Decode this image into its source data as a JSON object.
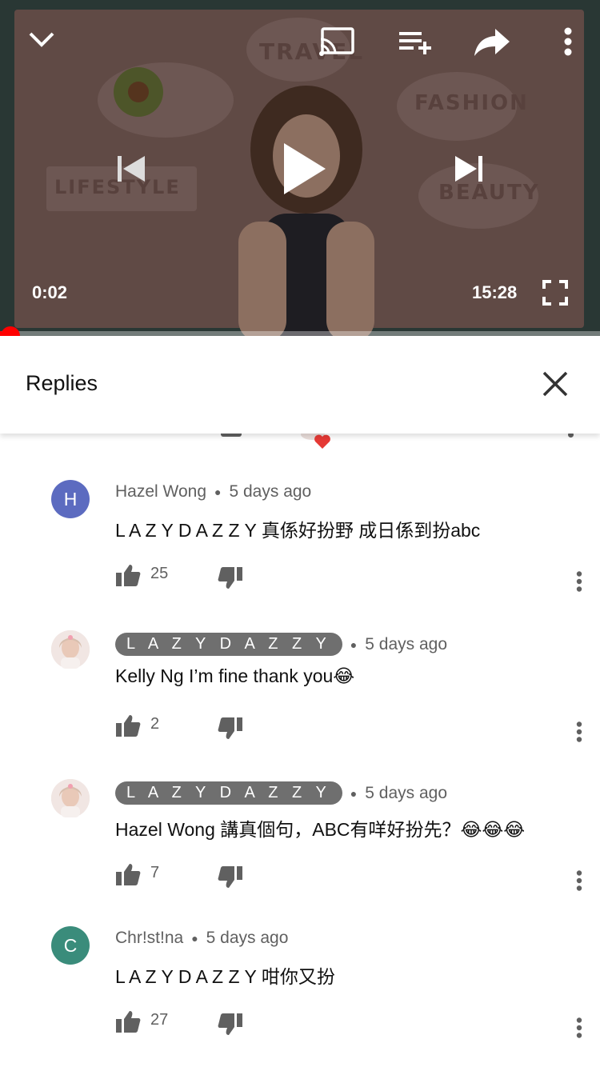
{
  "player": {
    "current_time": "0:02",
    "duration": "15:28",
    "progress": 0.002,
    "thumbnail_words": [
      "TRAVEL",
      "FASHION",
      "LIFESTYLE",
      "BEAUTY"
    ],
    "icons": [
      "chevron-down-icon",
      "cast-icon",
      "add-to-queue-icon",
      "share-icon",
      "more-vert-icon",
      "previous-icon",
      "play-icon",
      "next-icon",
      "fullscreen-icon"
    ],
    "accent_color": "#ff0000"
  },
  "replies": {
    "title": "Replies",
    "close_icon": "close-icon"
  },
  "comments": [
    {
      "author": "Hazel Wong",
      "avatar_letter": "H",
      "avatar_color": "#5c6bc0",
      "is_creator": false,
      "time": "5 days ago",
      "text": "L A Z Y D A Z Z Y 真係好扮野 成日係到扮abc",
      "likes": "25"
    },
    {
      "author": "L A Z Y D A Z Z Y",
      "avatar_letter": "",
      "avatar_color": "#e8dcd8",
      "is_creator": true,
      "time": "5 days ago",
      "text": "Kelly Ng I’m fine thank you😂",
      "likes": "2"
    },
    {
      "author": "L A Z Y D A Z Z Y",
      "avatar_letter": "",
      "avatar_color": "#e8dcd8",
      "is_creator": true,
      "time": "5 days ago",
      "text": "Hazel Wong 講真個句，ABC有咩好扮先？😂😂😂",
      "likes": "7"
    },
    {
      "author": "Chr!st!na",
      "avatar_letter": "C",
      "avatar_color": "#3a8c7b",
      "is_creator": false,
      "time": "5 days ago",
      "text": "L A Z Y D A Z Z Y 咁你又扮",
      "likes": "27"
    }
  ]
}
